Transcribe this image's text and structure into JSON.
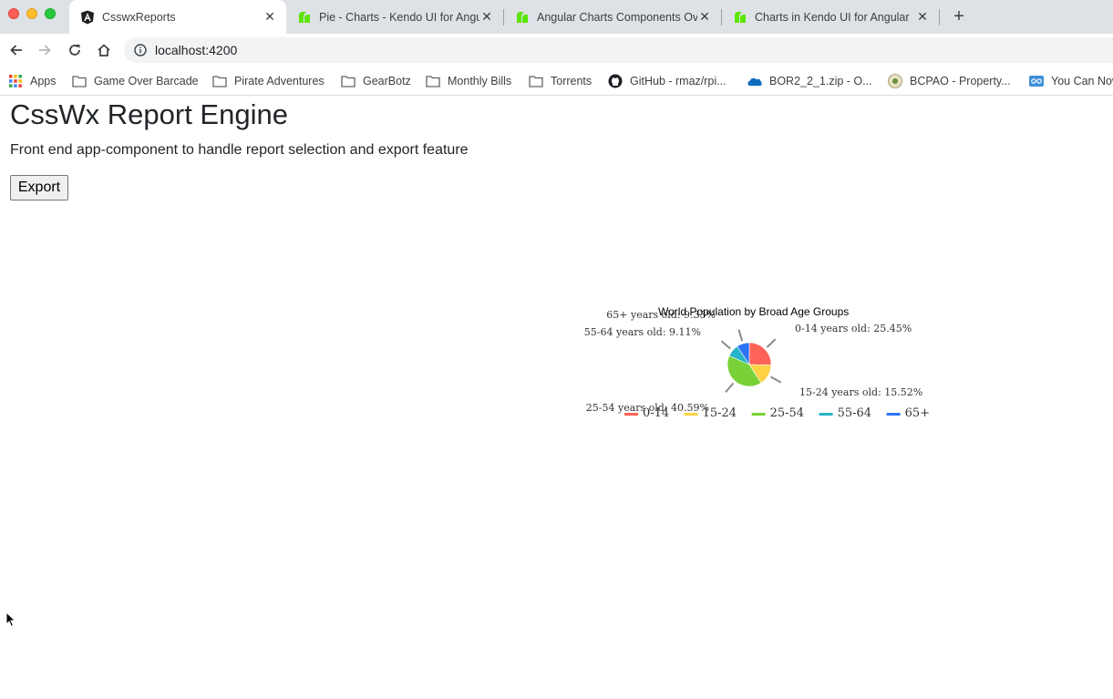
{
  "browser": {
    "tabs": [
      {
        "title": "CsswxReports",
        "favicon": "angular-icon",
        "active": true
      },
      {
        "title": "Pie - Charts - Kendo UI for Angular",
        "favicon": "kendo-icon",
        "active": false
      },
      {
        "title": "Angular Charts Components Overview",
        "favicon": "kendo-icon",
        "active": false
      },
      {
        "title": "Charts in Kendo UI for Angular",
        "favicon": "kendo-icon",
        "active": false
      }
    ],
    "url": "localhost:4200",
    "bookmarks": [
      {
        "label": "Apps",
        "icon": "apps-grid-icon"
      },
      {
        "label": "Game Over Barcade",
        "icon": "folder-icon"
      },
      {
        "label": "Pirate Adventures",
        "icon": "folder-icon"
      },
      {
        "label": "GearBotz",
        "icon": "folder-icon"
      },
      {
        "label": "Monthly Bills",
        "icon": "folder-icon"
      },
      {
        "label": "Torrents",
        "icon": "folder-icon"
      },
      {
        "label": "GitHub - rmaz/rpi...",
        "icon": "github-icon"
      },
      {
        "label": "BOR2_2_1.zip - O...",
        "icon": "onedrive-icon"
      },
      {
        "label": "BCPAO - Property...",
        "icon": "bcpao-icon"
      },
      {
        "label": "You Can Now",
        "icon": "odoo-icon"
      }
    ]
  },
  "page": {
    "heading": "CssWx Report Engine",
    "subtitle": "Front end app-component to handle report selection and export feature",
    "export_label": "Export"
  },
  "chart_data": {
    "type": "pie",
    "title": "World Population by Broad Age Groups",
    "series": [
      {
        "name": "0-14",
        "label": "0-14 years old: 25.45%",
        "value": 25.45,
        "color": "#ff6358"
      },
      {
        "name": "15-24",
        "label": "15-24 years old: 15.52%",
        "value": 15.52,
        "color": "#ffd246"
      },
      {
        "name": "25-54",
        "label": "25-54 years old: 40.59%",
        "value": 40.59,
        "color": "#78d237"
      },
      {
        "name": "55-64",
        "label": "55-64 years old: 9.11%",
        "value": 9.11,
        "color": "#28b4c8"
      },
      {
        "name": "65+",
        "label": "65+ years old: 9.33%",
        "value": 9.33,
        "color": "#2d73f5"
      }
    ],
    "legend_position": "bottom"
  }
}
